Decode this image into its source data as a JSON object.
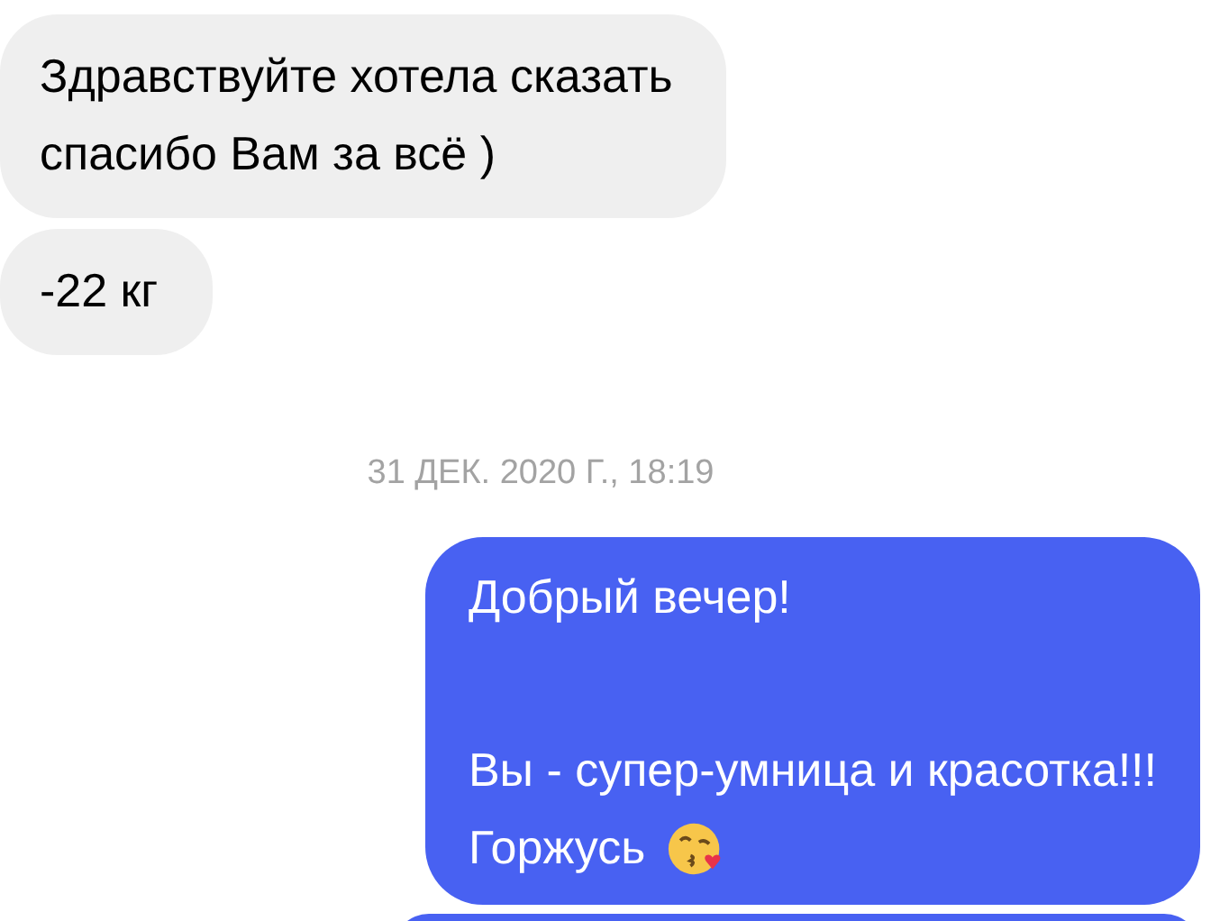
{
  "messages": [
    {
      "kind": "incoming",
      "paragraphs": [
        [
          "Здравствуйте хотела сказать",
          "спасибо Вам за всё )"
        ]
      ]
    },
    {
      "kind": "incoming",
      "paragraphs": [
        [
          "-22 кг"
        ]
      ]
    },
    {
      "kind": "timestamp",
      "paragraphs": [
        [
          "31 ДЕК. 2020 Г., 18:19"
        ]
      ]
    },
    {
      "kind": "outgoing",
      "paragraphs": [
        [
          "Добрый вечер!"
        ],
        [
          "Вы - супер-умница и красотка!!!",
          "Горжусь"
        ]
      ],
      "emoji": true
    },
    {
      "kind": "outgoing_cut"
    }
  ]
}
